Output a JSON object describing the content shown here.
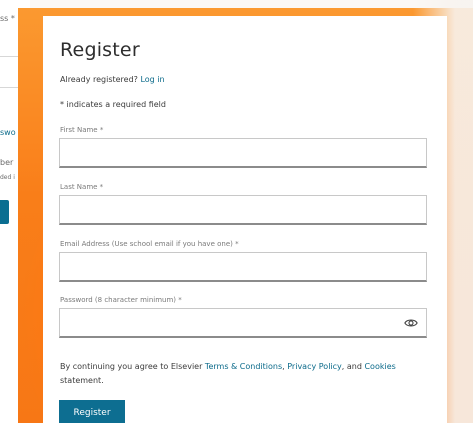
{
  "background": {
    "left_texts": [
      "ss *",
      "swo",
      "ber",
      "ded i"
    ],
    "accent_orange": "#f47f1f",
    "accent_teal": "#0d6e91"
  },
  "form": {
    "title": "Register",
    "already_registered": "Already registered?",
    "login_link": "Log in",
    "required_note": "* indicates a required field",
    "fields": [
      {
        "label": "First Name *",
        "value": "",
        "type": "text"
      },
      {
        "label": "Last Name *",
        "value": "",
        "type": "text"
      },
      {
        "label": "Email Address (Use school email if you have one) *",
        "value": "",
        "type": "email"
      },
      {
        "label": "Password (8 character minimum) *",
        "value": "",
        "type": "password",
        "icon": "eye-icon"
      }
    ],
    "terms": {
      "prefix": "By continuing you agree to Elsevier ",
      "terms_link": "Terms & Conditions",
      "sep1": ", ",
      "privacy_link": "Privacy Policy",
      "sep2": ", and ",
      "cookies_link": "Cookies",
      "suffix": " statement."
    },
    "submit_label": "Register"
  }
}
